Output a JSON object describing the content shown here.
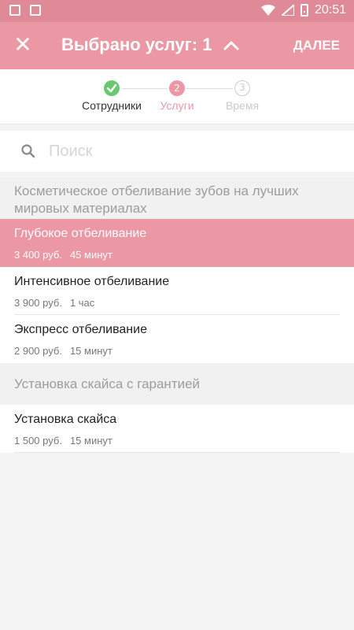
{
  "status_bar": {
    "time": "20:51",
    "icons": [
      "image-icon",
      "a-icon",
      "wifi-icon",
      "signal-icon",
      "battery-icon"
    ]
  },
  "app_bar": {
    "title": "Выбрано услуг: 1",
    "next_label": "ДАЛЕЕ",
    "background": "#eb97a4"
  },
  "stepper": {
    "steps": [
      {
        "number": "",
        "label": "Сотрудники",
        "state": "done"
      },
      {
        "number": "2",
        "label": "Услуги",
        "state": "active"
      },
      {
        "number": "3",
        "label": "Время",
        "state": "pending"
      }
    ]
  },
  "search": {
    "placeholder": "Поиск",
    "value": ""
  },
  "sections": [
    {
      "title": "Косметическое отбеливание зубов на лучших мировых материалах",
      "items": [
        {
          "name": "Глубокое отбеливание",
          "price": "3 400 руб.",
          "duration": "45 минут",
          "selected": true
        },
        {
          "name": "Интенсивное отбеливание",
          "price": "3 900 руб.",
          "duration": "1 час",
          "selected": false
        },
        {
          "name": "Экспресс отбеливание",
          "price": "2 900 руб.",
          "duration": "15 минут",
          "selected": false
        }
      ]
    },
    {
      "title": "Установка скайса с гарантией",
      "items": [
        {
          "name": "Установка скайса",
          "price": "1 500 руб.",
          "duration": "15 минут",
          "selected": false
        }
      ]
    }
  ]
}
